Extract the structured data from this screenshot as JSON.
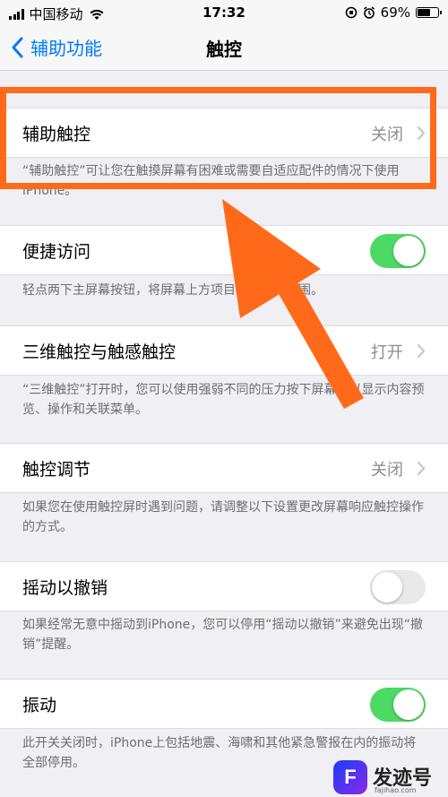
{
  "status_bar": {
    "carrier": "中国移动",
    "time": "17:32",
    "battery_percent": "69%",
    "battery_level": 0.69
  },
  "nav": {
    "back_label": "辅助功能",
    "title": "触控"
  },
  "settings": {
    "assistive_touch": {
      "label": "辅助触控",
      "value": "关闭",
      "footer": "“辅助触控”可让您在触摸屏幕有困难或需要自适应配件的情况下使用iPhone。"
    },
    "reachability": {
      "label": "便捷访问",
      "enabled": true,
      "footer": "轻点两下主屏幕按钮，将屏幕上方项目移至可及范围。"
    },
    "touch_3d": {
      "label": "三维触控与触感触控",
      "value": "打开",
      "footer": "“三维触控”打开时，您可以使用强弱不同的压力按下屏幕，以显示内容预览、操作和关联菜单。"
    },
    "touch_accommodations": {
      "label": "触控调节",
      "value": "关闭",
      "footer": "如果您在使用触控屏时遇到问题，请调整以下设置更改屏幕响应触控操作的方式。"
    },
    "shake_to_undo": {
      "label": "摇动以撤销",
      "enabled": false,
      "footer": "如果经常无意中摇动到iPhone，您可以停用“摇动以撤销”来避免出现“撤销”提醒。"
    },
    "vibration": {
      "label": "振动",
      "enabled": true,
      "footer": "此开关关闭时，iPhone上包括地震、海啸和其他紧急警报在内的振动将全部停用。"
    }
  },
  "annotation": {
    "color": "#ff6a1a"
  },
  "watermark": {
    "icon_letter": "F",
    "text": "发迹号",
    "url": "fajihao.com"
  },
  "colors": {
    "accent": "#007aff",
    "toggle_on": "#4cd964",
    "background": "#efeff4"
  }
}
